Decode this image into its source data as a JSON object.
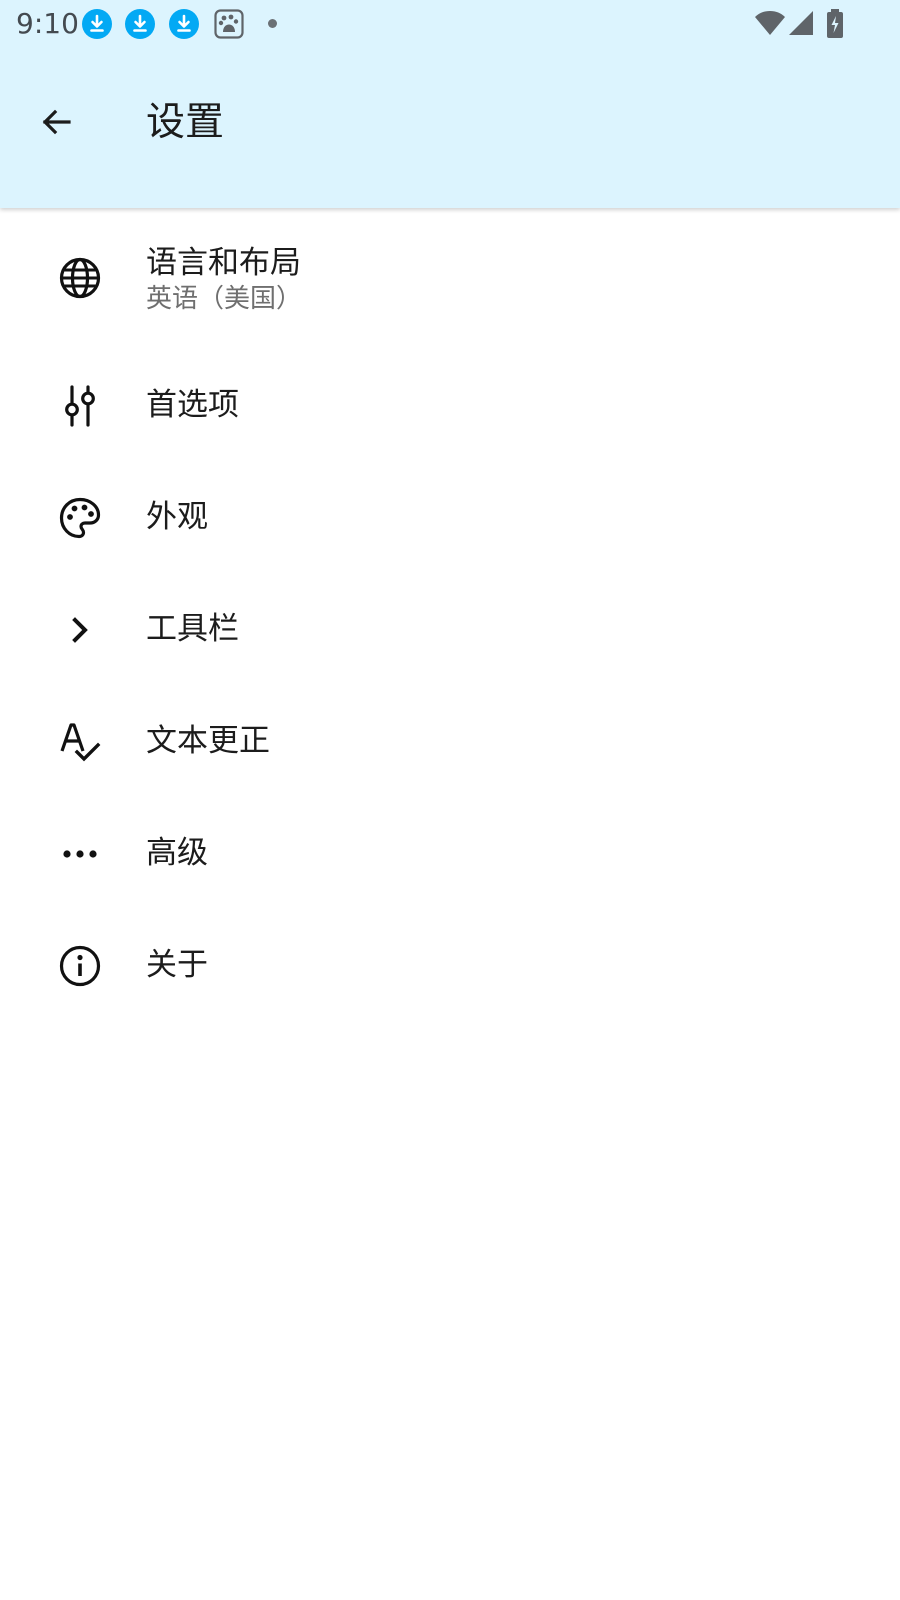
{
  "status_bar": {
    "time": "9:10",
    "notification_icons": [
      "download-icon",
      "download-icon",
      "download-icon",
      "baidu-paw-icon"
    ],
    "system_icons": [
      "wifi-icon",
      "cell-signal-icon",
      "battery-charging-icon"
    ]
  },
  "app_bar": {
    "title": "设置",
    "back_icon": "arrow-back-icon"
  },
  "settings": {
    "items": [
      {
        "title": "语言和布局",
        "summary": "英语（美国）",
        "icon": "globe-icon"
      },
      {
        "title": "首选项",
        "icon": "sliders-icon"
      },
      {
        "title": "外观",
        "icon": "palette-icon"
      },
      {
        "title": "工具栏",
        "icon": "chevron-right-icon"
      },
      {
        "title": "文本更正",
        "icon": "spellcheck-icon"
      },
      {
        "title": "高级",
        "icon": "more-horiz-icon"
      },
      {
        "title": "关于",
        "icon": "info-icon"
      }
    ]
  },
  "colors": {
    "top_bar_background": "#dcf4fe",
    "notification_accent": "#03a9f4",
    "primary_text": "#1c1c1c",
    "secondary_text": "#6f6f6f"
  }
}
